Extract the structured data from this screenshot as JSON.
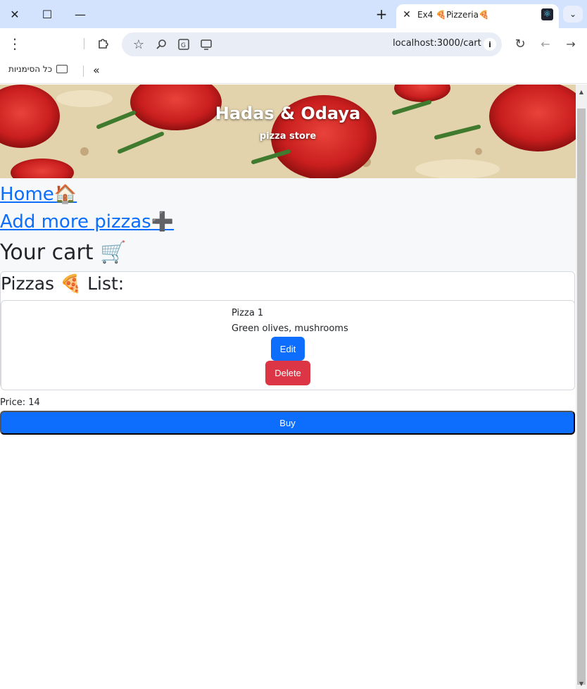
{
  "browser": {
    "tab_title": "Ex4 🍕Pizzeria🍕",
    "url": "localhost:3000/cart",
    "bookmarks_folder_label": "כל הסימניות",
    "icons": {
      "close": "close-icon",
      "maximize": "maximize-icon",
      "minimize": "minimize-icon",
      "new_tab": "plus-icon",
      "tab_favicon": "react-icon",
      "tab_list": "chevron-down-icon",
      "menu": "kebab-menu-icon",
      "extensions": "puzzle-icon",
      "bookmark": "star-icon",
      "zoom": "zoom-icon",
      "translate": "translate-icon",
      "cast": "cast-icon",
      "site_info": "info-icon",
      "reload": "reload-icon",
      "back": "arrow-left-icon",
      "forward": "arrow-right-icon",
      "more_bookmarks": "double-chevron-icon",
      "folder": "folder-icon"
    },
    "glyphs": {
      "close": "✕",
      "maximize": "☐",
      "minimize": "—",
      "new_tab": "+",
      "tab_list": "⌄",
      "menu": "⋮",
      "extensions": "⧉",
      "bookmark": "☆",
      "zoom": "⌕",
      "translate": "⇄",
      "cast": "▭",
      "site_info": "i",
      "reload": "↻",
      "back": "←",
      "forward": "→",
      "more_bookmarks": "«",
      "react": "⚛"
    }
  },
  "header": {
    "title": "Hadas & Odaya",
    "subtitle": "pizza store"
  },
  "nav": {
    "home_label": "Home🏠",
    "add_label": "Add more pizzas➕"
  },
  "cart": {
    "title": "Your cart 🛒",
    "list_title": "Pizzas 🍕 List:",
    "items": [
      {
        "name": "Pizza 1",
        "toppings": "Green olives, mushrooms",
        "edit_label": "Edit",
        "delete_label": "Delete"
      }
    ],
    "price_text": "Price: 14",
    "buy_label": "Buy"
  },
  "colors": {
    "primary": "#0d6efd",
    "danger": "#dc3545",
    "link": "#0d6efd",
    "tab_strip": "#d3e3fd"
  }
}
